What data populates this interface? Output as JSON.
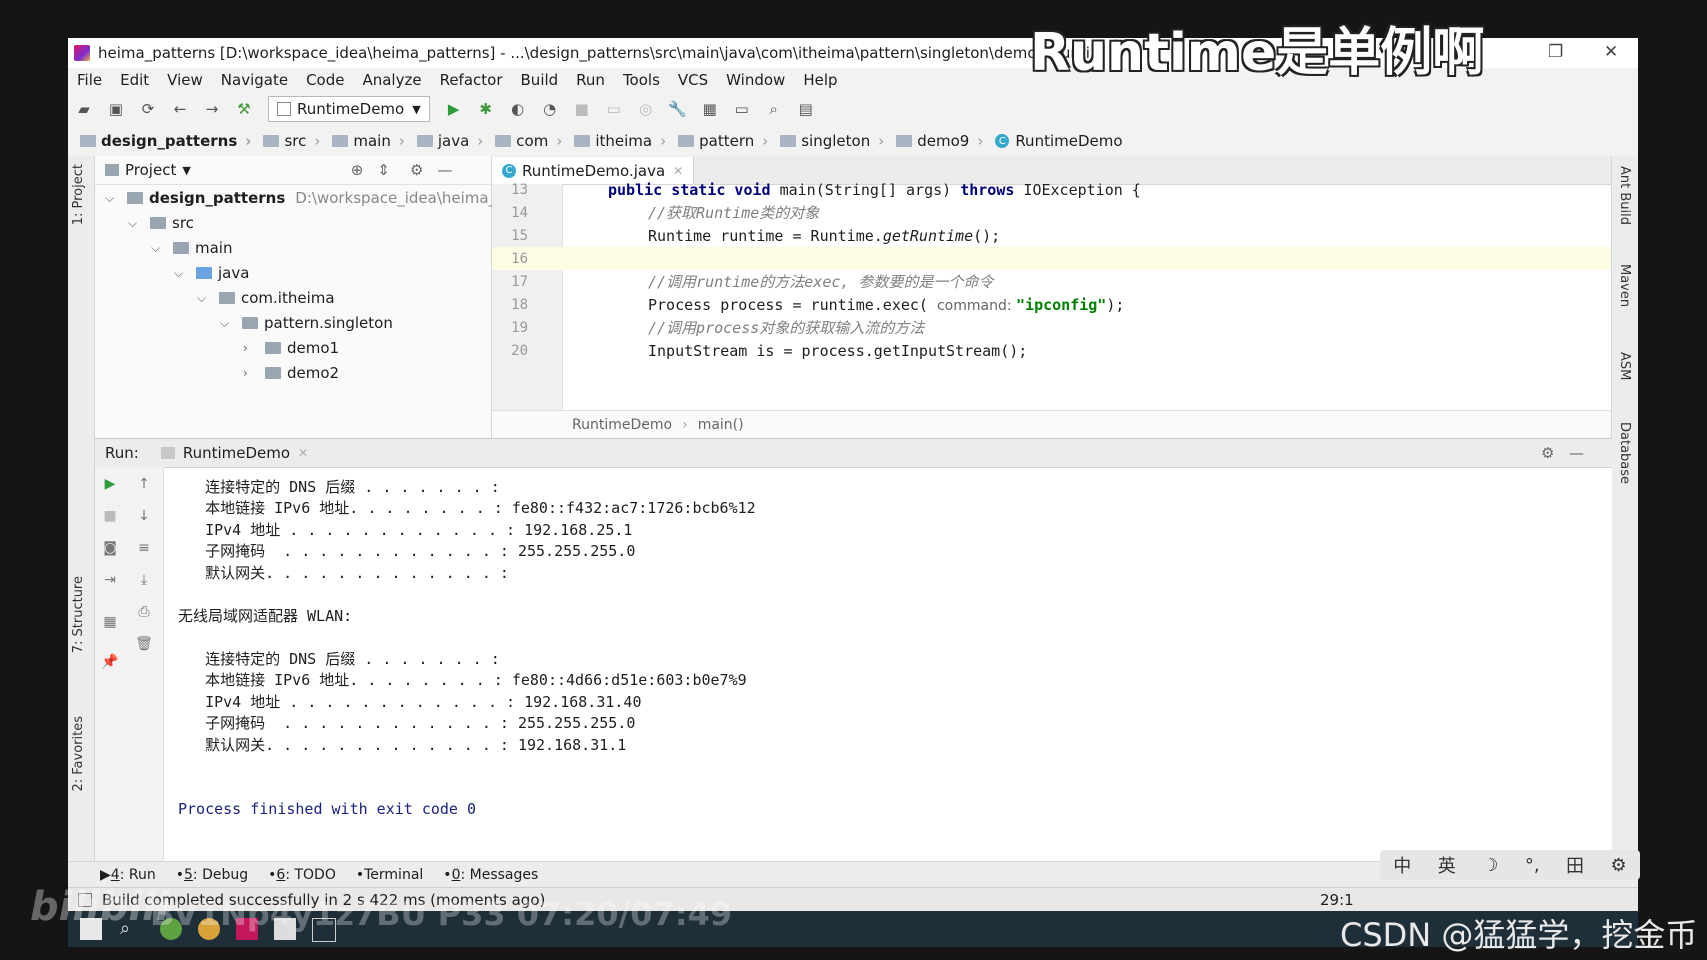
{
  "window": {
    "title": "heima_patterns [D:\\workspace_idea\\heima_patterns] - ...\\design_patterns\\src\\main\\java\\com\\itheima\\pattern\\singleton\\demo9\\Runti"
  },
  "overlay": {
    "caption": "Runtime是单例啊"
  },
  "menu": [
    "File",
    "Edit",
    "View",
    "Navigate",
    "Code",
    "Analyze",
    "Refactor",
    "Build",
    "Run",
    "Tools",
    "VCS",
    "Window",
    "Help"
  ],
  "toolbar": {
    "run_config": "RuntimeDemo"
  },
  "breadcrumb": [
    "design_patterns",
    "src",
    "main",
    "java",
    "com",
    "itheima",
    "pattern",
    "singleton",
    "demo9",
    "RuntimeDemo"
  ],
  "project_panel": {
    "title": "Project",
    "tree": [
      {
        "label": "design_patterns",
        "hint": "D:\\workspace_idea\\heima_patte",
        "depth": 0,
        "expanded": true
      },
      {
        "label": "src",
        "depth": 1,
        "expanded": true
      },
      {
        "label": "main",
        "depth": 2,
        "expanded": true
      },
      {
        "label": "java",
        "depth": 3,
        "expanded": true
      },
      {
        "label": "com.itheima",
        "depth": 4,
        "expanded": true
      },
      {
        "label": "pattern.singleton",
        "depth": 5,
        "expanded": true
      },
      {
        "label": "demo1",
        "depth": 6,
        "expanded": false
      },
      {
        "label": "demo2",
        "depth": 6,
        "expanded": false
      }
    ]
  },
  "editor": {
    "tab": "RuntimeDemo.java",
    "line_numbers": [
      "13",
      "14",
      "15",
      "16",
      "17",
      "18",
      "19",
      "20"
    ],
    "lines": {
      "l13_a": "public static void",
      "l13_b": " main(String[] args) ",
      "l13_c": "throws",
      "l13_d": " IOException {",
      "l14": "//获取Runtime类的对象",
      "l15_a": "Runtime runtime = Runtime.",
      "l15_b": "getRuntime",
      "l15_c": "();",
      "l17": "//调用runtime的方法exec, 参数要的是一个命令",
      "l18_a": "Process process = runtime.exec( ",
      "l18_hint": "command: ",
      "l18_str": "\"ipconfig\"",
      "l18_c": ");",
      "l19": "//调用process对象的获取输入流的方法",
      "l20": "InputStream is = process.getInputStream();"
    },
    "crumb_class": "RuntimeDemo",
    "crumb_method": "main()"
  },
  "run_panel": {
    "label": "Run:",
    "tab": "RuntimeDemo",
    "console": [
      "   连接特定的 DNS 后缀 . . . . . . . :",
      "   本地链接 IPv6 地址. . . . . . . . : fe80::f432:ac7:1726:bcb6%12",
      "   IPv4 地址 . . . . . . . . . . . . : 192.168.25.1",
      "   子网掩码  . . . . . . . . . . . . : 255.255.255.0",
      "   默认网关. . . . . . . . . . . . . :",
      "",
      "无线局域网适配器 WLAN:",
      "",
      "   连接特定的 DNS 后缀 . . . . . . . :",
      "   本地链接 IPv6 地址. . . . . . . . : fe80::4d66:d51e:603:b0e7%9",
      "   IPv4 地址 . . . . . . . . . . . . : 192.168.31.40",
      "   子网掩码  . . . . . . . . . . . . : 255.255.255.0",
      "   默认网关. . . . . . . . . . . . . : 192.168.31.1",
      "",
      "",
      "Process finished with exit code 0"
    ]
  },
  "bottom_tabs": [
    {
      "num": "4",
      "label": ": Run"
    },
    {
      "num": "5",
      "label": ": Debug"
    },
    {
      "num": "6",
      "label": ": TODO"
    },
    {
      "num": "",
      "label": "Terminal"
    },
    {
      "num": "0",
      "label": ": Messages"
    }
  ],
  "status": {
    "message": "Build completed successfully in 2 s 422 ms (moments ago)",
    "position": "29:1"
  },
  "side_tabs": {
    "left": [
      "1: Project",
      "7: Structure",
      "2: Favorites"
    ],
    "right": [
      "Ant Build",
      "Maven",
      "ASM",
      "Database"
    ]
  },
  "watermarks": {
    "bilibili": "bilibili",
    "video": "BV1Np4y1z7BU P33 07:20/07:49",
    "csdn": "CSDN @猛猛学，挖金币"
  },
  "ime": [
    "中",
    "英",
    "☽",
    "°,",
    "田",
    "⚙"
  ]
}
